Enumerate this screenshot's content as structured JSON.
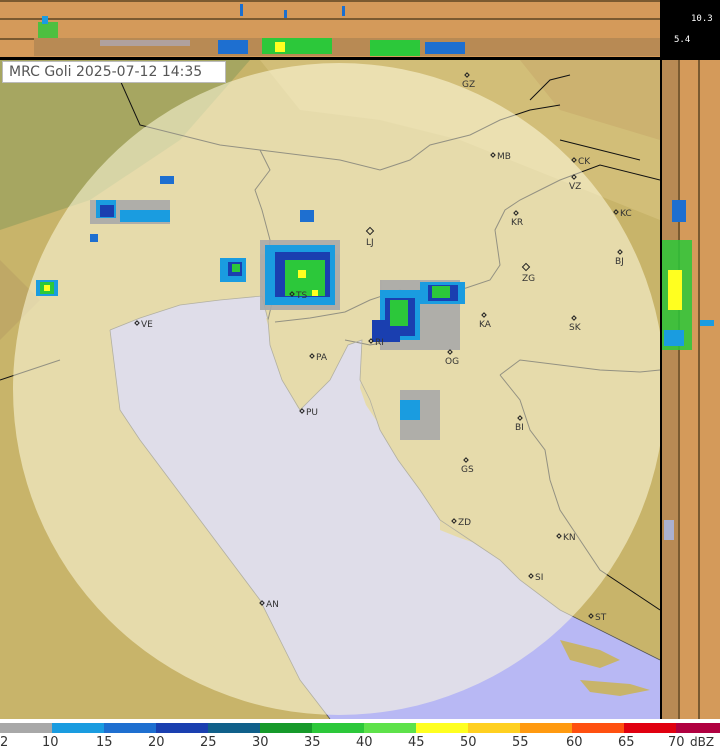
{
  "title": {
    "station": "MRC Goli",
    "date": "2025-07-12",
    "time": "14:35"
  },
  "side_panel": {
    "height_top": "10.3",
    "height_mid": "5.4"
  },
  "cities": [
    {
      "code": "GZ"
    },
    {
      "code": "MB"
    },
    {
      "code": "CK"
    },
    {
      "code": "VZ"
    },
    {
      "code": "KC"
    },
    {
      "code": "KR"
    },
    {
      "code": "LJ"
    },
    {
      "code": "BJ"
    },
    {
      "code": "ZG"
    },
    {
      "code": "TS"
    },
    {
      "code": "VE"
    },
    {
      "code": "KA"
    },
    {
      "code": "SK"
    },
    {
      "code": "RI"
    },
    {
      "code": "PA"
    },
    {
      "code": "OG"
    },
    {
      "code": "PU"
    },
    {
      "code": "BI"
    },
    {
      "code": "GS"
    },
    {
      "code": "ZD"
    },
    {
      "code": "KN"
    },
    {
      "code": "SI"
    },
    {
      "code": "AN"
    },
    {
      "code": "ST"
    }
  ],
  "legend": {
    "unit": "dBZ",
    "ticks": [
      "2",
      "10",
      "15",
      "20",
      "25",
      "30",
      "35",
      "40",
      "45",
      "50",
      "55",
      "60",
      "65",
      "70"
    ],
    "colors": [
      "#a8a8a8",
      "#1a9ce0",
      "#1e6fd0",
      "#1a3fb0",
      "#10608a",
      "#169a2a",
      "#2cc83a",
      "#5ee24a",
      "#ffff20",
      "#ffd020",
      "#ff9a10",
      "#ff5010",
      "#e00010",
      "#b00040",
      "#800080"
    ]
  },
  "colors": {
    "sea": "#b8b8f4",
    "land": "#caba72",
    "radar_circle": "#fffbe0"
  }
}
